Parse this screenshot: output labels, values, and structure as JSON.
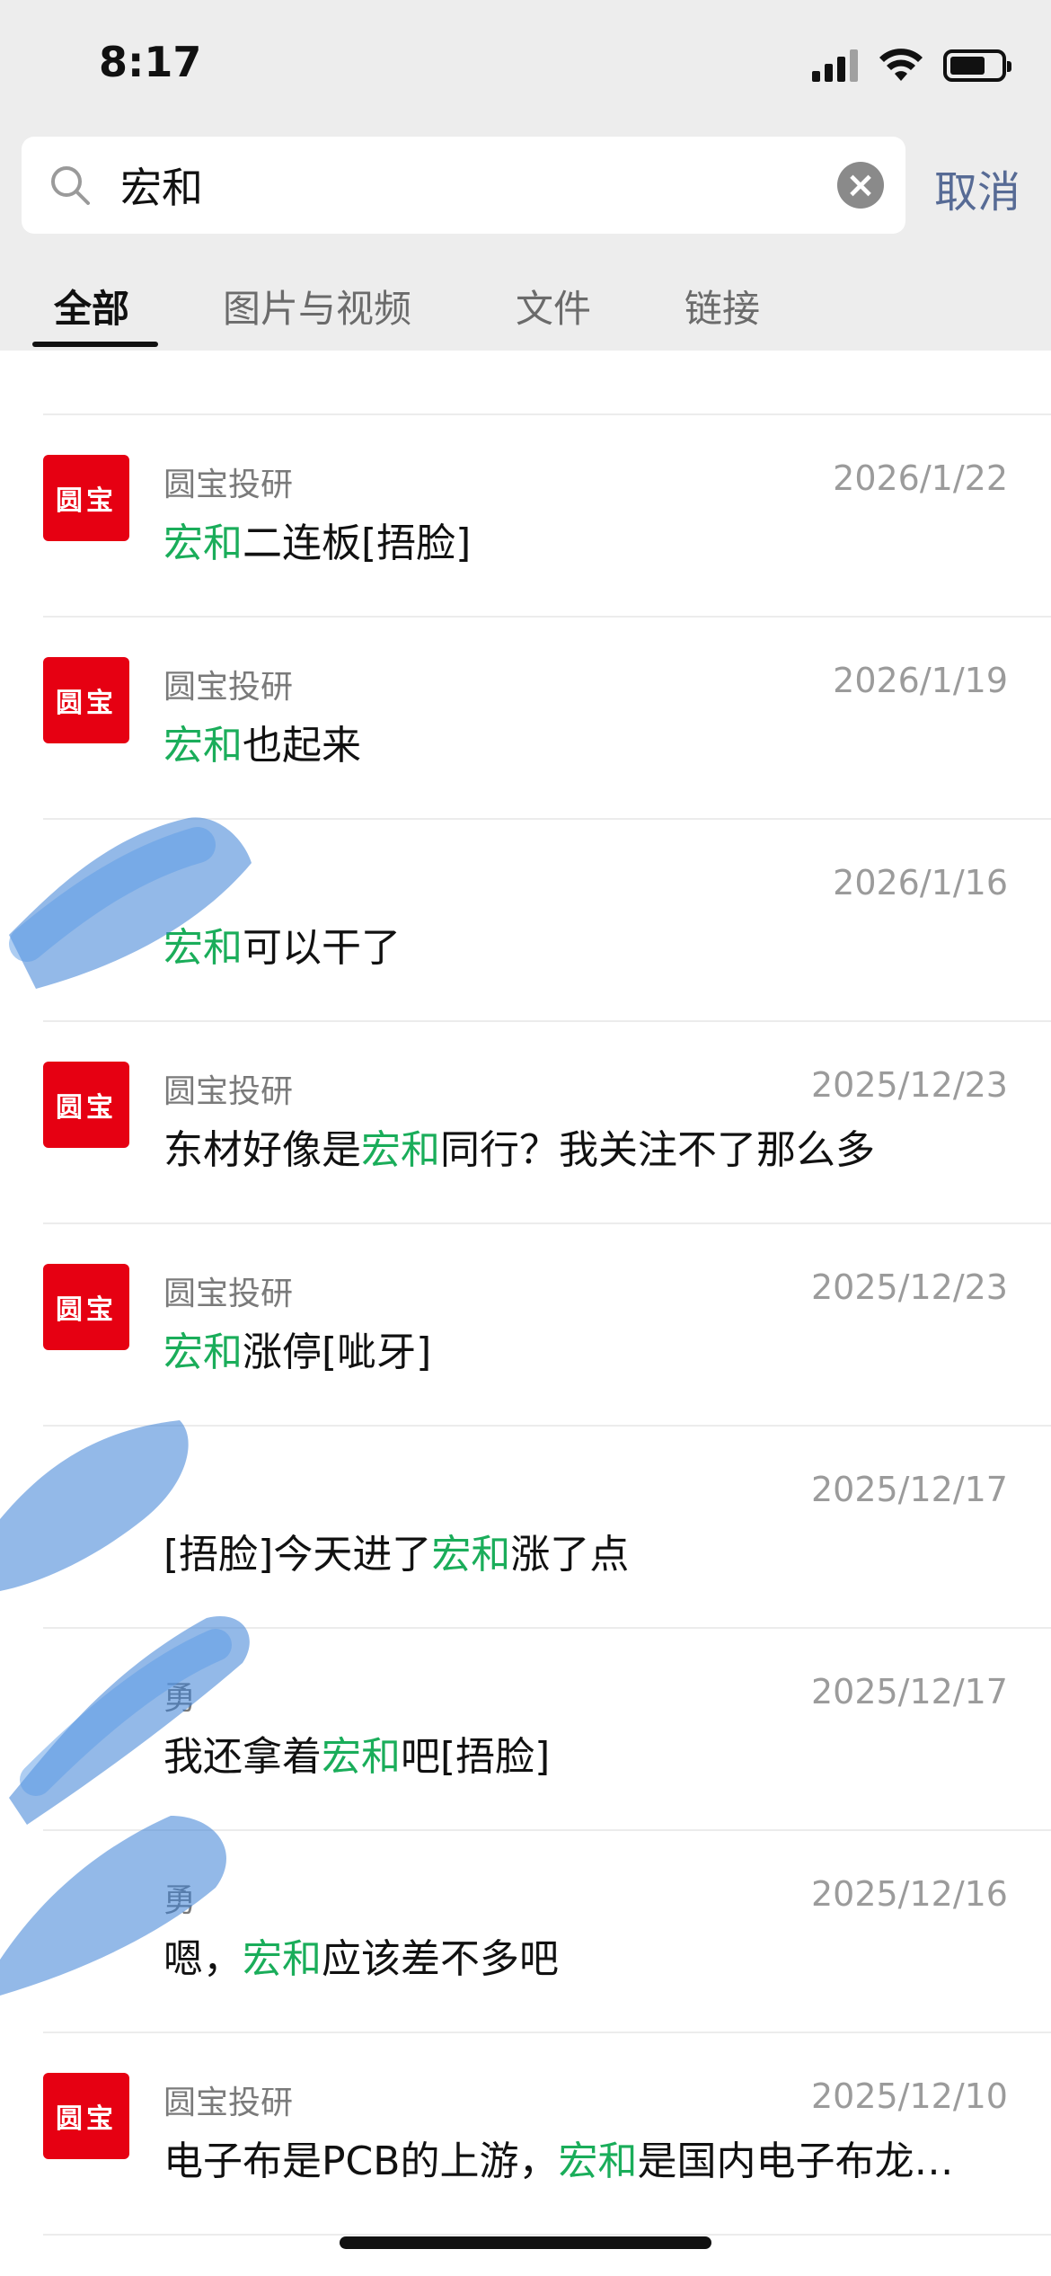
{
  "status_bar": {
    "time": "8:17"
  },
  "search": {
    "query": "宏和",
    "cancel_label": "取消"
  },
  "tabs": [
    {
      "label": "全部",
      "active": true
    },
    {
      "label": "图片与视频",
      "active": false
    },
    {
      "label": "文件",
      "active": false
    },
    {
      "label": "链接",
      "active": false
    }
  ],
  "results": [
    {
      "sender": "圆宝投研",
      "date": "2026/1/22",
      "pre": "",
      "highlight": "宏和",
      "post": "二连板[捂脸]",
      "avatar": "圆宝",
      "avatar_visible": true
    },
    {
      "sender": "圆宝投研",
      "date": "2026/1/19",
      "pre": "",
      "highlight": "宏和",
      "post": "也起来",
      "avatar": "圆宝",
      "avatar_visible": true
    },
    {
      "sender": "",
      "date": "2026/1/16",
      "pre": "",
      "highlight": "宏和",
      "post": "可以干了",
      "avatar": "",
      "avatar_visible": false
    },
    {
      "sender": "圆宝投研",
      "date": "2025/12/23",
      "pre": "东材好像是",
      "highlight": "宏和",
      "post": "同行？我关注不了那么多",
      "avatar": "圆宝",
      "avatar_visible": true
    },
    {
      "sender": "圆宝投研",
      "date": "2025/12/23",
      "pre": "",
      "highlight": "宏和",
      "post": "涨停[呲牙]",
      "avatar": "圆宝",
      "avatar_visible": true
    },
    {
      "sender": "",
      "date": "2025/12/17",
      "pre": "[捂脸]今天进了",
      "highlight": "宏和",
      "post": "涨了点",
      "avatar": "",
      "avatar_visible": false
    },
    {
      "sender": "勇",
      "date": "2025/12/17",
      "pre": "我还拿着",
      "highlight": "宏和",
      "post": "吧[捂脸]",
      "avatar": "",
      "avatar_visible": false
    },
    {
      "sender": "勇",
      "date": "2025/12/16",
      "pre": "嗯，",
      "highlight": "宏和",
      "post": "应该差不多吧",
      "avatar": "",
      "avatar_visible": false
    },
    {
      "sender": "圆宝投研",
      "date": "2025/12/10",
      "pre": "电子布是PCB的上游，",
      "highlight": "宏和",
      "post": "是国内电子布龙…",
      "avatar": "圆宝",
      "avatar_visible": true
    }
  ],
  "colors": {
    "highlight": "#1aad5a",
    "avatar_bg": "#e60012",
    "cancel": "#576b95",
    "scribble": "#3a7fd6"
  },
  "icons": [
    "signal-icon",
    "wifi-icon",
    "battery-icon",
    "search-icon",
    "clear-icon"
  ]
}
